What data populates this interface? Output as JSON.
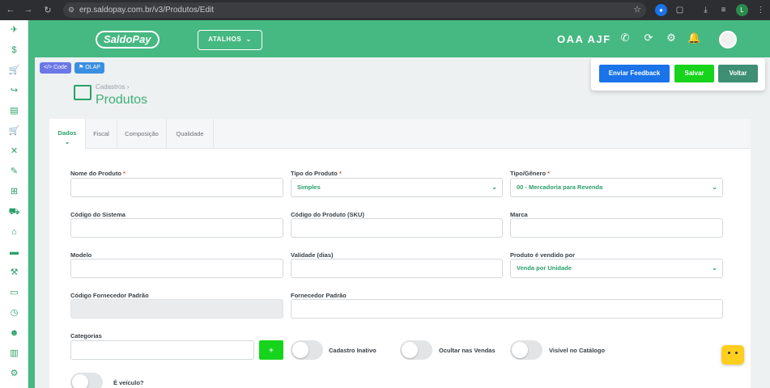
{
  "browser": {
    "url": "erp.saldopay.com.br/v3/Produtos/Edit",
    "profile_initial": "L"
  },
  "header": {
    "logo": "SaldoPay",
    "atalhos": "ATALHOS",
    "company": "OAA AJF"
  },
  "badges": {
    "code": "Code",
    "olap": "OLAP"
  },
  "actions": {
    "feedback": "Enviar Feedback",
    "save": "Salvar",
    "back": "Voltar"
  },
  "breadcrumb": {
    "parent": "Cadastros",
    "title": "Produtos"
  },
  "tabs": [
    "Dados",
    "Fiscal",
    "Composição",
    "Qualidade"
  ],
  "form": {
    "nome": {
      "label": "Nome do Produto",
      "required": "*",
      "value": ""
    },
    "tipo": {
      "label": "Tipo do Produto",
      "required": "*",
      "value": "Simples"
    },
    "genero": {
      "label": "Tipo/Gênero",
      "required": "*",
      "value": "00 - Mercadoria para Revenda"
    },
    "codigo_sistema": {
      "label": "Código do Sistema",
      "value": ""
    },
    "sku": {
      "label": "Código do Produto (SKU)",
      "value": ""
    },
    "marca": {
      "label": "Marca",
      "value": ""
    },
    "modelo": {
      "label": "Modelo",
      "value": ""
    },
    "validade": {
      "label": "Validade (dias)",
      "value": ""
    },
    "vendido_por": {
      "label": "Produto é vendido por",
      "value": "Venda por Unidade"
    },
    "cod_fornecedor": {
      "label": "Código Fornecedor Padrão",
      "value": ""
    },
    "fornecedor": {
      "label": "Fornecedor Padrão",
      "value": ""
    },
    "categorias": {
      "label": "Categorias",
      "value": "",
      "add_label": "+"
    },
    "toggles": {
      "inativo": "Cadastro Inativo",
      "ocultar": "Ocultar nas Vendas",
      "catalogo": "Visível no Catálogo",
      "veiculo": "É veículo?"
    }
  },
  "colors": {
    "brand": "#46b882",
    "save": "#16d41c",
    "feedback": "#1a73e8",
    "back": "#3e8f73"
  }
}
